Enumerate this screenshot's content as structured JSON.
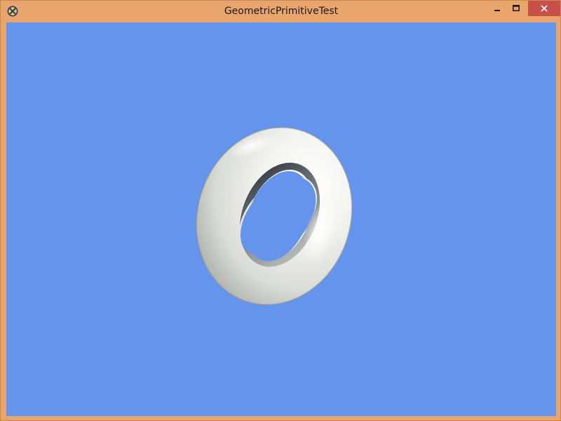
{
  "window": {
    "title": "GeometricPrimitiveTest",
    "controls": {
      "minimize": "minimize",
      "maximize": "maximize",
      "close": "close"
    }
  },
  "colors": {
    "frame": "#e9a56c",
    "viewport_background": "#6494ec",
    "close_button": "#c7504a",
    "torus": "#f2f2ef"
  },
  "scene": {
    "object": "torus"
  }
}
